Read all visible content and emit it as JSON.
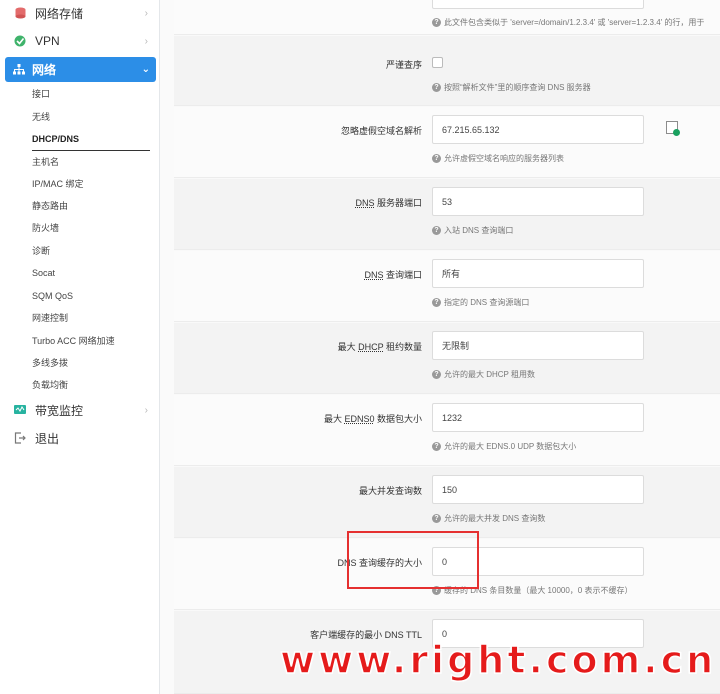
{
  "sidebar": {
    "storage_label": "网络存储",
    "vpn_label": "VPN",
    "network_label": "网络",
    "bandwidth_label": "带宽监控",
    "logout_label": "退出",
    "sub_items": [
      {
        "label": "接口"
      },
      {
        "label": "无线"
      },
      {
        "label": "DHCP/DNS"
      },
      {
        "label": "主机名"
      },
      {
        "label": "IP/MAC 绑定"
      },
      {
        "label": "静态路由"
      },
      {
        "label": "防火墙"
      },
      {
        "label": "诊断"
      },
      {
        "label": "Socat"
      },
      {
        "label": "SQM QoS"
      },
      {
        "label": "网速控制"
      },
      {
        "label": "Turbo ACC 网络加速"
      },
      {
        "label": "多线多拨"
      },
      {
        "label": "负载均衡"
      }
    ],
    "colors": {
      "active_bg": "#2c8ee7"
    },
    "icons": [
      "storage-icon",
      "vpn-icon",
      "network-icon",
      "chevron-down-icon",
      "bandwidth-icon",
      "logout-icon"
    ]
  },
  "form": {
    "top_hint": "此文件包含类似于 'server=/domain/1.2.3.4' 或 'server=1.2.3.4' 的行，用于",
    "strict_order": {
      "label": "严谨查序",
      "hint": "按照“解析文件”里的顺序查询 DNS 服务器"
    },
    "bogus_nx": {
      "label": "忽略虚假空域名解析",
      "value": "67.215.65.132",
      "hint": "允许虚假空域名响应的服务器列表"
    },
    "dns_port": {
      "label_abbr": "DNS",
      "label_rest": " 服务器端口",
      "value": "53",
      "hint": "入站 DNS 查询端口"
    },
    "query_port": {
      "label_abbr": "DNS",
      "label_rest": " 查询端口",
      "value": "所有",
      "hint": "指定的 DNS 查询源端口"
    },
    "max_dhcp": {
      "label_pre": "最大 ",
      "label_abbr": "DHCP",
      "label_rest": " 租约数量",
      "value": "无限制",
      "hint": "允许的最大 DHCP 租用数"
    },
    "edns": {
      "label_pre": "最大 ",
      "label_abbr": "EDNS0",
      "label_rest": " 数据包大小",
      "value": "1232",
      "hint": "允许的最大 EDNS.0 UDP 数据包大小"
    },
    "concurrent": {
      "label": "最大并发查询数",
      "value": "150",
      "hint": "允许的最大并发 DNS 查询数"
    },
    "cache_size": {
      "label": "DNS 查询缓存的大小",
      "value": "0",
      "hint": "缓存的 DNS 条目数量（最大 10000，0 表示不缓存）"
    },
    "min_ttl": {
      "label": "客户端缓存的最小 DNS TTL",
      "value": "0"
    }
  },
  "watermark": "www.right.com.cn",
  "colors": {
    "highlight": "#e53030",
    "watermark": "#e51b1b"
  }
}
